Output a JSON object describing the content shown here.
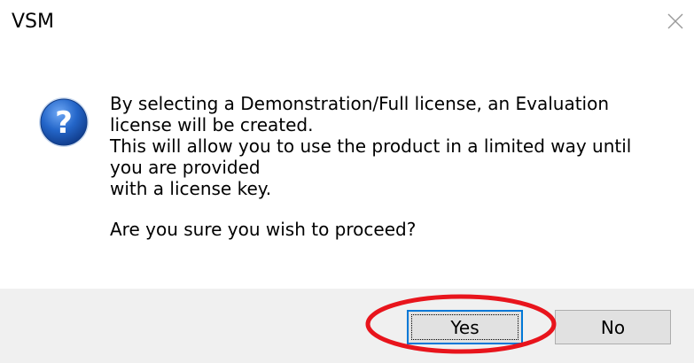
{
  "window": {
    "title": "VSM",
    "close_icon": "close-icon"
  },
  "dialog": {
    "icon": "question-icon",
    "icon_glyph": "?",
    "message_lines": [
      "By selecting a Demonstration/Full license, an Evaluation",
      "license will be created.",
      "This will allow you to use the product in a limited way until",
      "you are provided",
      "with a license key."
    ],
    "confirm_question": "Are you sure you wish to proceed?"
  },
  "buttons": {
    "yes_label": "Yes",
    "no_label": "No"
  },
  "annotation": {
    "color": "#e8141c"
  },
  "colors": {
    "button_bar": "#f0f0f0",
    "button_face": "#e1e1e1",
    "focus_border": "#0078d7",
    "icon_blue": "#1f5fbf"
  }
}
